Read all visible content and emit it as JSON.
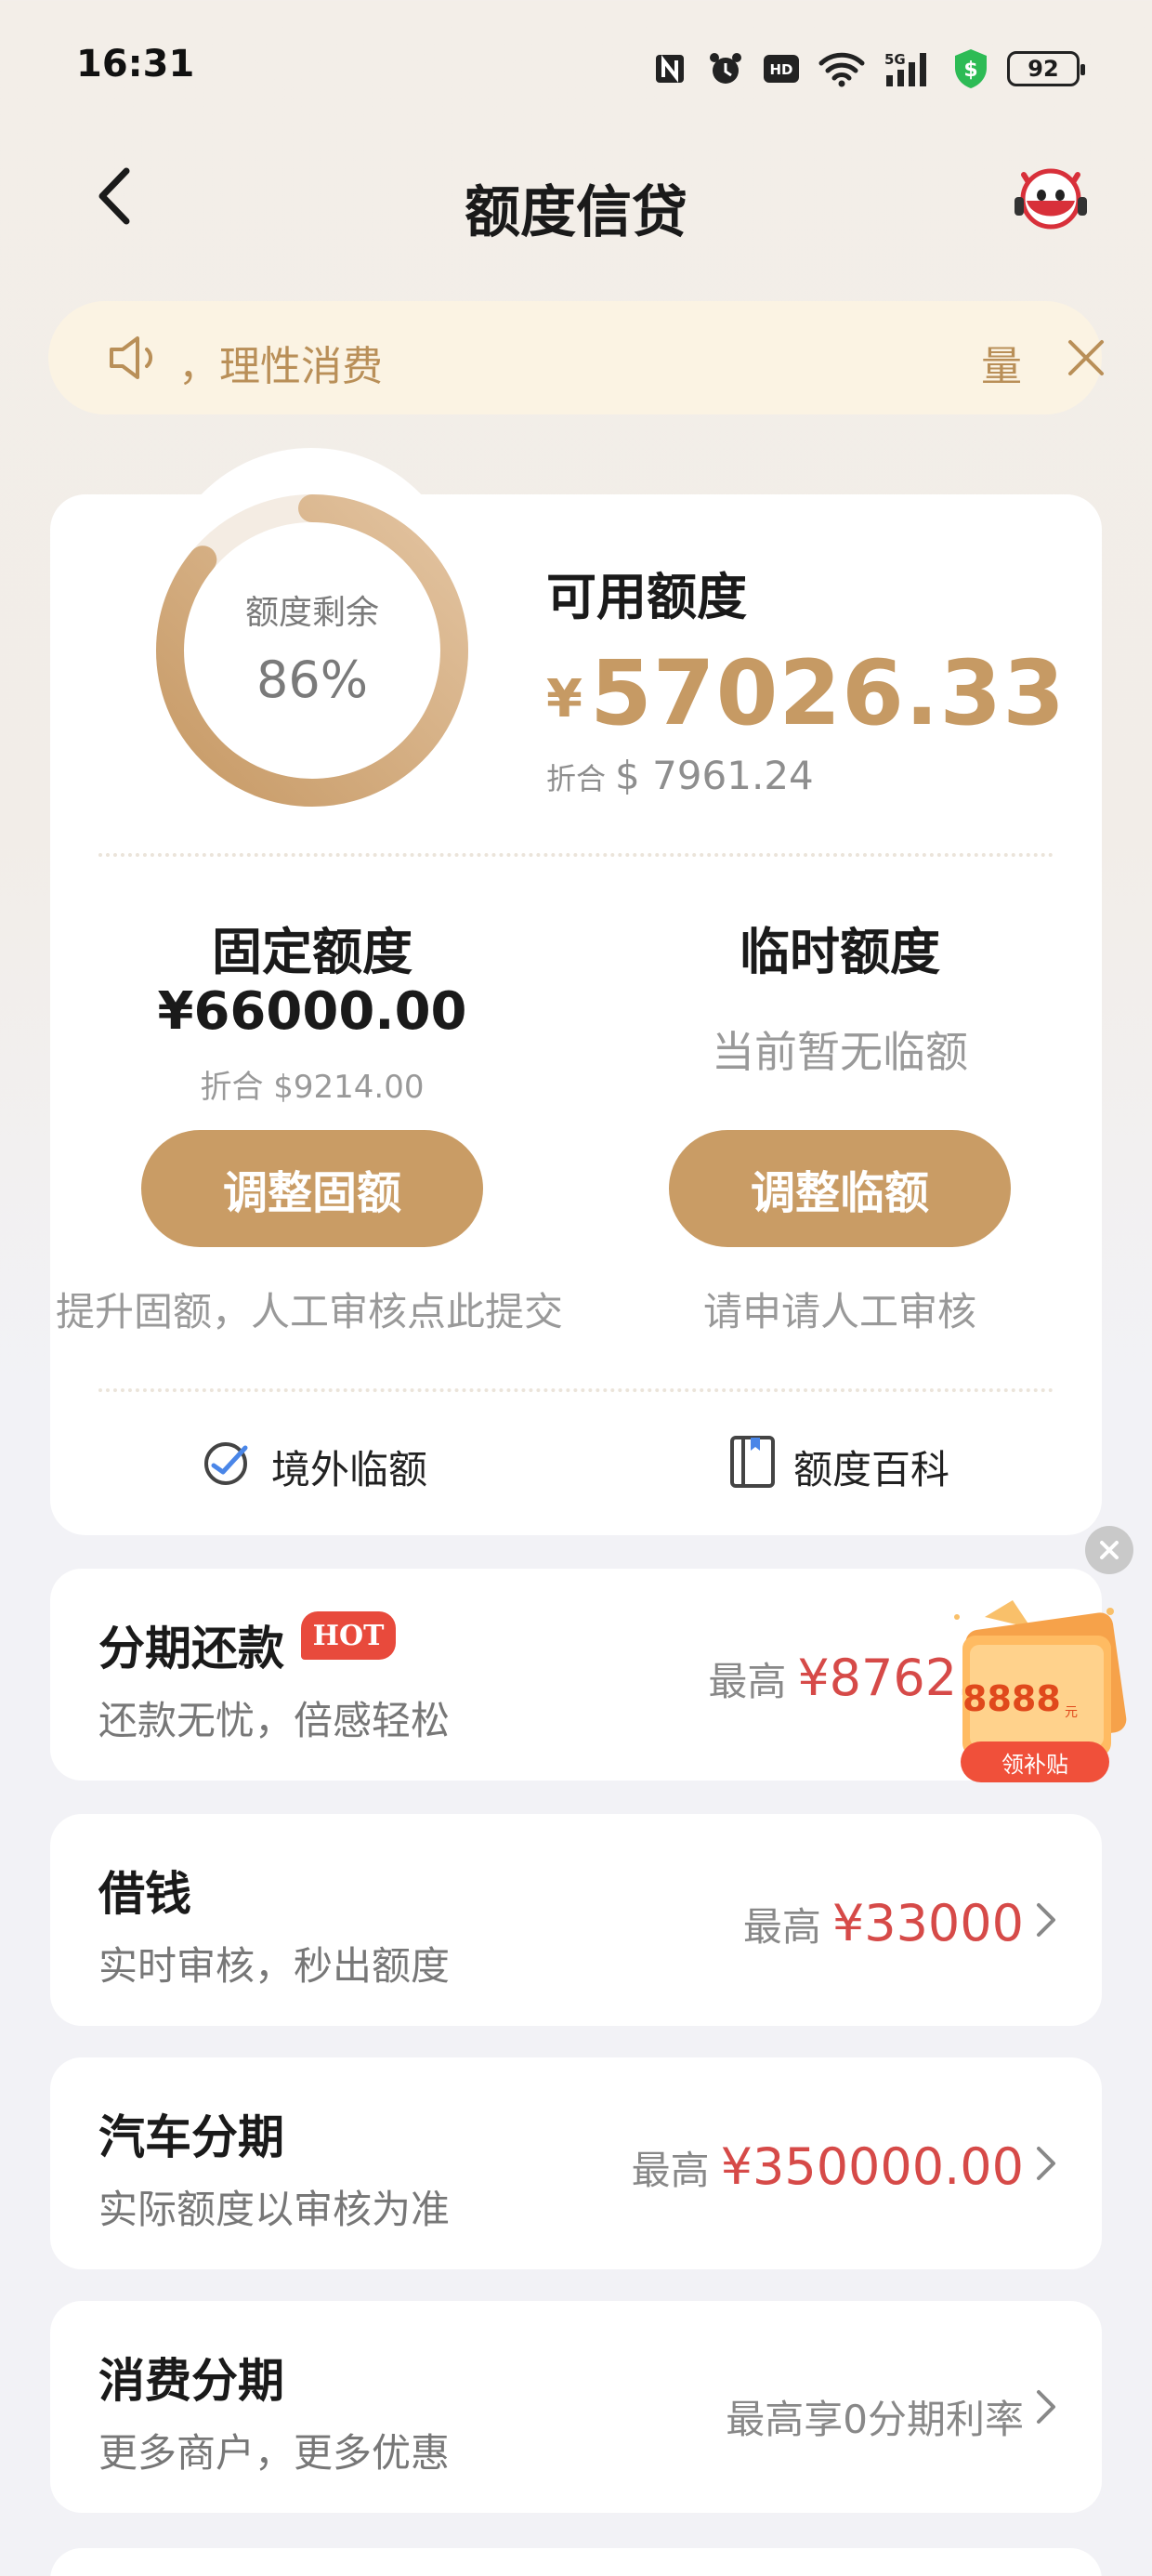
{
  "status_bar": {
    "time": "16:31",
    "battery": "92",
    "icons": [
      "nfc-icon",
      "alarm-icon",
      "hd-icon",
      "wifi-icon",
      "5g-signal-icon",
      "security-shield-icon",
      "battery-icon"
    ]
  },
  "nav": {
    "title": "额度信贷",
    "back_icon": "chevron-left-icon",
    "mascot_icon": "mascot-icon"
  },
  "notice": {
    "text": "，理性消费",
    "right_text": "量",
    "icon": "speaker-icon"
  },
  "credit": {
    "ring_label": "额度剩余",
    "ring_value": "86%",
    "ring_fraction": 0.86,
    "available_label": "可用额度",
    "available_currency": "¥",
    "available_amount": "57026.33",
    "converted_label": "折合",
    "converted_value": "$ 7961.24",
    "fixed": {
      "title": "固定额度",
      "amount": "¥66000.00",
      "converted": "折合 $9214.00",
      "button": "调整固额",
      "hint": "提升固额，人工审核点此提交"
    },
    "temporary": {
      "title": "临时额度",
      "status": "当前暂无临额",
      "button": "调整临额",
      "hint": "请申请人工审核"
    },
    "links": [
      {
        "label": "境外临额",
        "icon": "globe-plane-icon"
      },
      {
        "label": "额度百科",
        "icon": "book-icon"
      }
    ]
  },
  "products": [
    {
      "title": "分期还款",
      "badge": "HOT",
      "subtitle": "还款无忧，倍感轻松",
      "right_label": "最高",
      "right_amount": "¥8762.00"
    },
    {
      "title": "借钱",
      "subtitle": "实时审核，秒出额度",
      "right_label": "最高",
      "right_amount": "¥33000"
    },
    {
      "title": "汽车分期",
      "subtitle": "实际额度以审核为准",
      "right_label": "最高",
      "right_amount": "¥350000.00"
    },
    {
      "title": "消费分期",
      "subtitle": "更多商户，更多优惠",
      "right_label": "最高享0分期利率",
      "right_amount": ""
    }
  ],
  "coupon": {
    "amount": "8888",
    "unit": "元",
    "label": "领补贴"
  },
  "colors": {
    "accent_gold": "#c99c65",
    "amount_red": "#d64a48",
    "notice_bg": "#fbf3e3"
  }
}
